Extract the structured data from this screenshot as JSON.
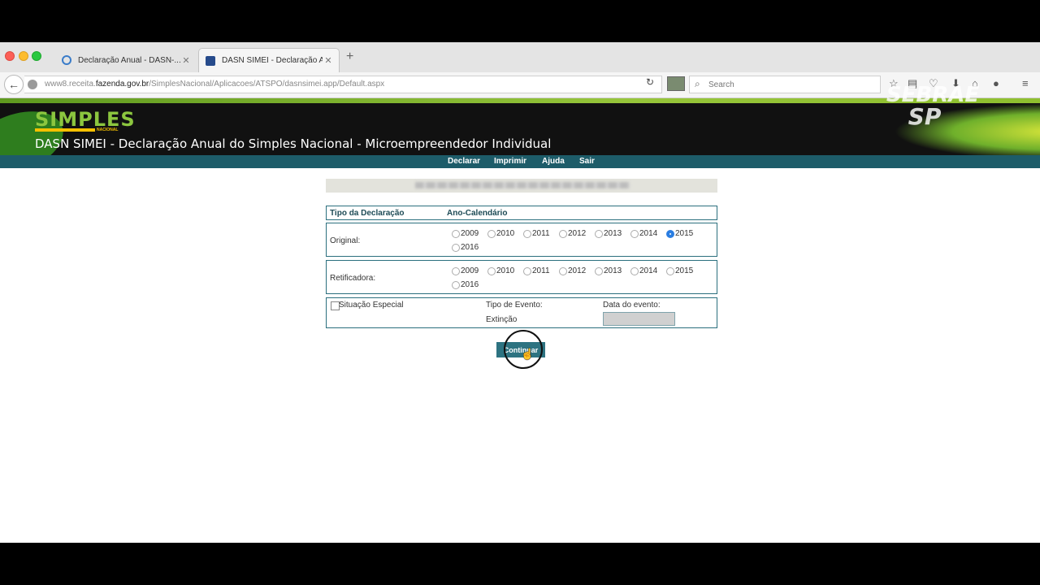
{
  "browser": {
    "tabs": [
      {
        "label": "Declaração Anual - DASN-..."
      },
      {
        "label": "DASN SIMEI - Declaração A..."
      }
    ],
    "url_prefix": "www8.receita.",
    "url_domain": "fazenda.gov.br",
    "url_path": "/SimplesNacional/Aplicacoes/ATSPO/dasnsimei.app/Default.aspx",
    "search_placeholder": "Search"
  },
  "header": {
    "logo": "SIMPLES",
    "logo_sub": "NACIONAL",
    "title": "DASN SIMEI - Declaração Anual do Simples Nacional - Microempreendedor Individual",
    "watermark_line1": "SEBRAE",
    "watermark_line2": "SP"
  },
  "menu": [
    "Declarar",
    "Imprimir",
    "Ajuda",
    "Sair"
  ],
  "form": {
    "col_tipo": "Tipo da Declaração",
    "col_ano": "Ano-Calendário",
    "original_label": "Original:",
    "retificadora_label": "Retificadora:",
    "years": [
      "2009",
      "2010",
      "2011",
      "2012",
      "2013",
      "2014",
      "2015",
      "2016"
    ],
    "original_selected": "2015",
    "situacao_especial": "Situação Especial",
    "tipo_evento_label": "Tipo de Evento:",
    "tipo_evento_value": "Extinção",
    "data_evento_label": "Data do evento:",
    "continue_button": "Continuar"
  }
}
